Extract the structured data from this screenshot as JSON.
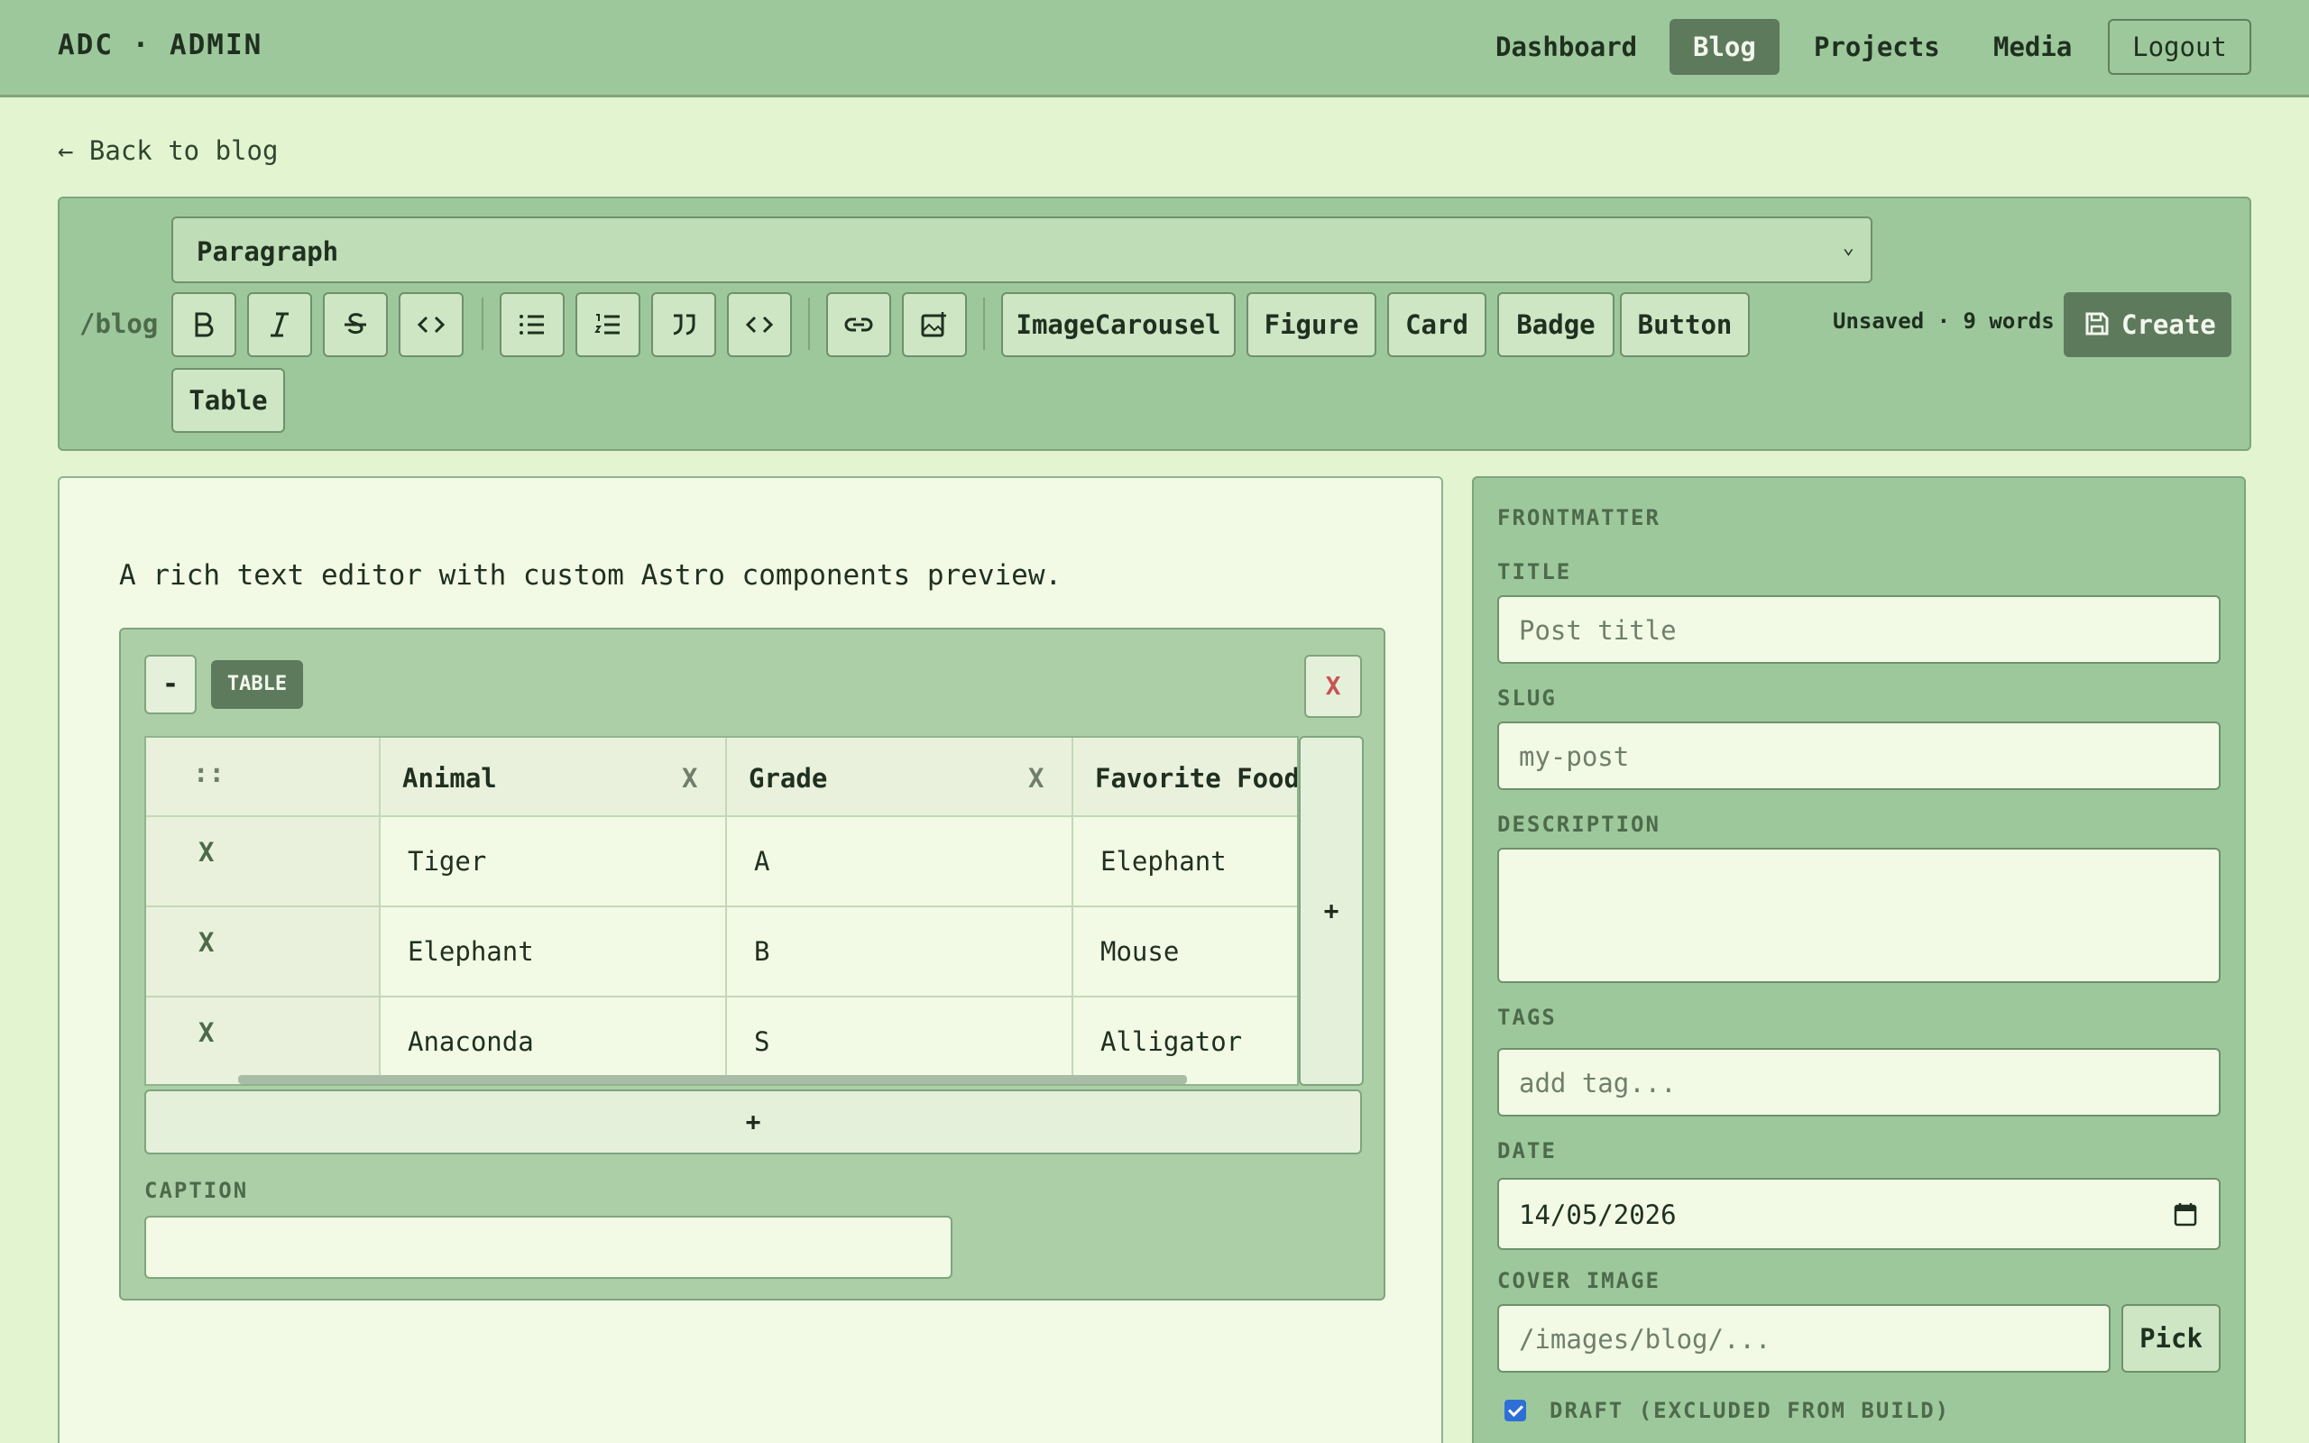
{
  "brand": "ADC · ADMIN",
  "nav": {
    "dashboard": "Dashboard",
    "blog": "Blog",
    "projects": "Projects",
    "media": "Media",
    "logout": "Logout"
  },
  "back_link": "← Back to blog",
  "toolbar": {
    "prefix": "/blog",
    "block_type": "Paragraph",
    "icons": [
      "bold-icon",
      "italic-icon",
      "strikethrough-icon",
      "inline-code-icon",
      "bullet-list-icon",
      "ordered-list-icon",
      "blockquote-icon",
      "code-block-icon",
      "link-icon",
      "image-icon"
    ],
    "components": [
      "ImageCarousel",
      "Figure",
      "Card",
      "Badge",
      "Button",
      "Table"
    ],
    "status": "Unsaved · 9 words",
    "create_label": "Create"
  },
  "editor": {
    "intro": "A rich text editor with custom Astro components preview.",
    "table_component": {
      "collapse_label": "-",
      "badge": "TABLE",
      "remove_label": "X",
      "drag_handle": "::",
      "headers": [
        "Animal",
        "Grade",
        "Favorite Food"
      ],
      "header_remove": "X",
      "row_remove": "X",
      "rows": [
        [
          "Tiger",
          "A",
          "Elephant"
        ],
        [
          "Elephant",
          "B",
          "Mouse"
        ],
        [
          "Anaconda",
          "S",
          "Alligator"
        ]
      ],
      "add_column": "+",
      "add_row": "+",
      "caption_label": "CAPTION",
      "caption_value": ""
    }
  },
  "frontmatter": {
    "heading": "FRONTMATTER",
    "title_label": "TITLE",
    "title_placeholder": "Post title",
    "slug_label": "SLUG",
    "slug_placeholder": "my-post",
    "description_label": "DESCRIPTION",
    "tags_label": "TAGS",
    "tags_placeholder": "add tag...",
    "date_label": "DATE",
    "date_value": "14/05/2026",
    "cover_label": "COVER IMAGE",
    "cover_placeholder": "/images/blog/...",
    "pick_label": "Pick",
    "draft_label": "DRAFT (EXCLUDED FROM BUILD)",
    "draft_checked": true
  },
  "colors": {
    "background": "#e2f5d0",
    "panel": "#9dc89c",
    "accent": "#5e7a5d",
    "remove_red": "#c65454"
  }
}
